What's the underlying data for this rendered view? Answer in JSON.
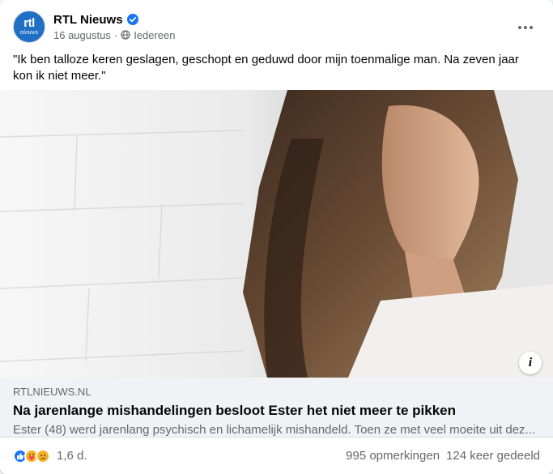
{
  "post": {
    "page_name": "RTL Nieuws",
    "date": "16 augustus",
    "separator": "·",
    "audience": "Iedereen",
    "text": "\"Ik ben talloze keren geslagen, geschopt en geduwd door mijn toenmalige man. Na zeven jaar kon ik niet meer.\""
  },
  "avatar": {
    "logo_top": "rtl",
    "logo_bottom": "nieuws"
  },
  "link": {
    "domain": "RTLNIEUWS.NL",
    "title": "Na jarenlange mishandelingen besloot Ester het niet meer te pikken",
    "description": "Ester (48) werd jarenlang psychisch en lichamelijk mishandeld. Toen ze met veel moeite uit dez..."
  },
  "footer": {
    "reaction_count": "1,6 d.",
    "comments": "995 opmerkingen",
    "shares": "124 keer gedeeld"
  },
  "icons": {
    "verified": "verified-badge-icon",
    "audience": "globe-icon",
    "more": "more-options-icon",
    "info": "info-icon",
    "reactions": [
      "like-reaction-icon",
      "care-reaction-icon",
      "sad-reaction-icon"
    ]
  },
  "colors": {
    "brand_blue": "#1877f2",
    "rtl_blue": "#1f6fc5",
    "secondary_text": "#65676b",
    "link_bg": "#f0f2f5"
  }
}
